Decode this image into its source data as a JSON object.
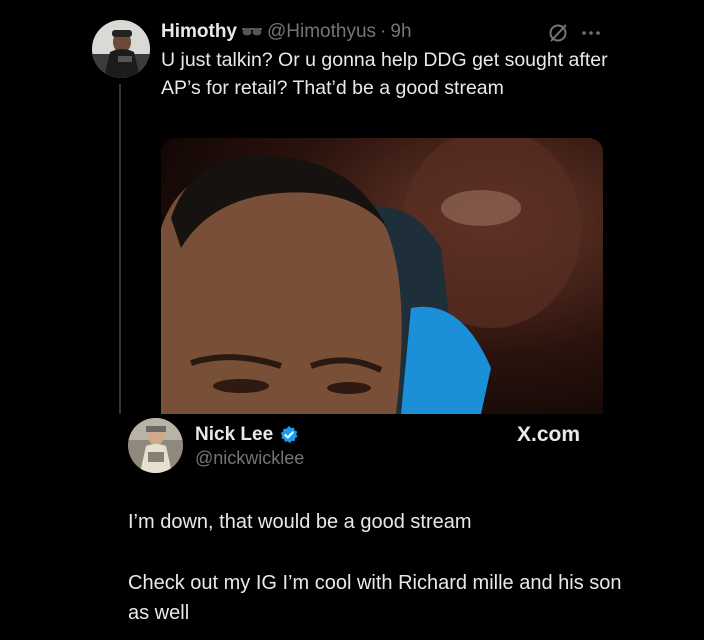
{
  "original_tweet": {
    "author_name": "Himothy",
    "name_emoji": "🕶",
    "handle": "@Himothyus",
    "separator": "·",
    "time": "9h",
    "text": "U just talkin? Or u gonna help DDG get sought after AP’s for retail? That’d be a good stream",
    "icons": [
      "grok-icon",
      "more-icon"
    ]
  },
  "reply_tweet": {
    "author_name": "Nick Lee",
    "handle": "@nickwicklee",
    "verified": true,
    "source": "X.com",
    "text_paragraph_1": "I’m down, that would be a good stream",
    "text_paragraph_2": "Check out my IG I’m cool with Richard mille and his son as well"
  },
  "colors": {
    "background": "#000000",
    "text": "#e7e9ea",
    "secondary_text": "#71767b",
    "verified_blue": "#1d9bf0"
  }
}
